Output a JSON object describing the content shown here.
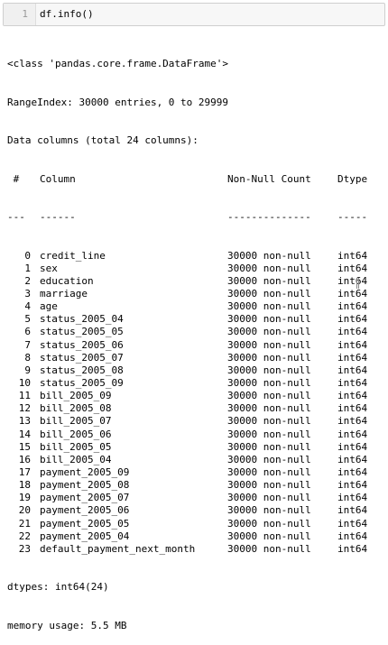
{
  "input_cell": {
    "line_number": "1",
    "code": "df.info()"
  },
  "output": {
    "class_line": "<class 'pandas.core.frame.DataFrame'>",
    "range_index": "RangeIndex: 30000 entries, 0 to 29999",
    "data_columns": "Data columns (total 24 columns):",
    "header": {
      "idx": " #",
      "column": "Column",
      "count": "Non-Null Count",
      "dtype": "Dtype"
    },
    "separator": {
      "idx": "---",
      "column": "------",
      "count": "--------------",
      "dtype": "-----"
    },
    "rows": [
      {
        "idx": "0",
        "column": "credit_line",
        "count": "30000 non-null",
        "dtype": "int64"
      },
      {
        "idx": "1",
        "column": "sex",
        "count": "30000 non-null",
        "dtype": "int64"
      },
      {
        "idx": "2",
        "column": "education",
        "count": "30000 non-null",
        "dtype": "int64"
      },
      {
        "idx": "3",
        "column": "marriage",
        "count": "30000 non-null",
        "dtype": "int64"
      },
      {
        "idx": "4",
        "column": "age",
        "count": "30000 non-null",
        "dtype": "int64"
      },
      {
        "idx": "5",
        "column": "status_2005_04",
        "count": "30000 non-null",
        "dtype": "int64"
      },
      {
        "idx": "6",
        "column": "status_2005_05",
        "count": "30000 non-null",
        "dtype": "int64"
      },
      {
        "idx": "7",
        "column": "status_2005_06",
        "count": "30000 non-null",
        "dtype": "int64"
      },
      {
        "idx": "8",
        "column": "status_2005_07",
        "count": "30000 non-null",
        "dtype": "int64"
      },
      {
        "idx": "9",
        "column": "status_2005_08",
        "count": "30000 non-null",
        "dtype": "int64"
      },
      {
        "idx": "10",
        "column": "status_2005_09",
        "count": "30000 non-null",
        "dtype": "int64"
      },
      {
        "idx": "11",
        "column": "bill_2005_09",
        "count": "30000 non-null",
        "dtype": "int64"
      },
      {
        "idx": "12",
        "column": "bill_2005_08",
        "count": "30000 non-null",
        "dtype": "int64"
      },
      {
        "idx": "13",
        "column": "bill_2005_07",
        "count": "30000 non-null",
        "dtype": "int64"
      },
      {
        "idx": "14",
        "column": "bill_2005_06",
        "count": "30000 non-null",
        "dtype": "int64"
      },
      {
        "idx": "15",
        "column": "bill_2005_05",
        "count": "30000 non-null",
        "dtype": "int64"
      },
      {
        "idx": "16",
        "column": "bill_2005_04",
        "count": "30000 non-null",
        "dtype": "int64"
      },
      {
        "idx": "17",
        "column": "payment_2005_09",
        "count": "30000 non-null",
        "dtype": "int64"
      },
      {
        "idx": "18",
        "column": "payment_2005_08",
        "count": "30000 non-null",
        "dtype": "int64"
      },
      {
        "idx": "19",
        "column": "payment_2005_07",
        "count": "30000 non-null",
        "dtype": "int64"
      },
      {
        "idx": "20",
        "column": "payment_2005_06",
        "count": "30000 non-null",
        "dtype": "int64"
      },
      {
        "idx": "21",
        "column": "payment_2005_05",
        "count": "30000 non-null",
        "dtype": "int64"
      },
      {
        "idx": "22",
        "column": "payment_2005_04",
        "count": "30000 non-null",
        "dtype": "int64"
      },
      {
        "idx": "23",
        "column": "default_payment_next_month",
        "count": "30000 non-null",
        "dtype": "int64"
      }
    ],
    "dtypes": "dtypes: int64(24)",
    "memory": "memory usage: 5.5 MB"
  }
}
